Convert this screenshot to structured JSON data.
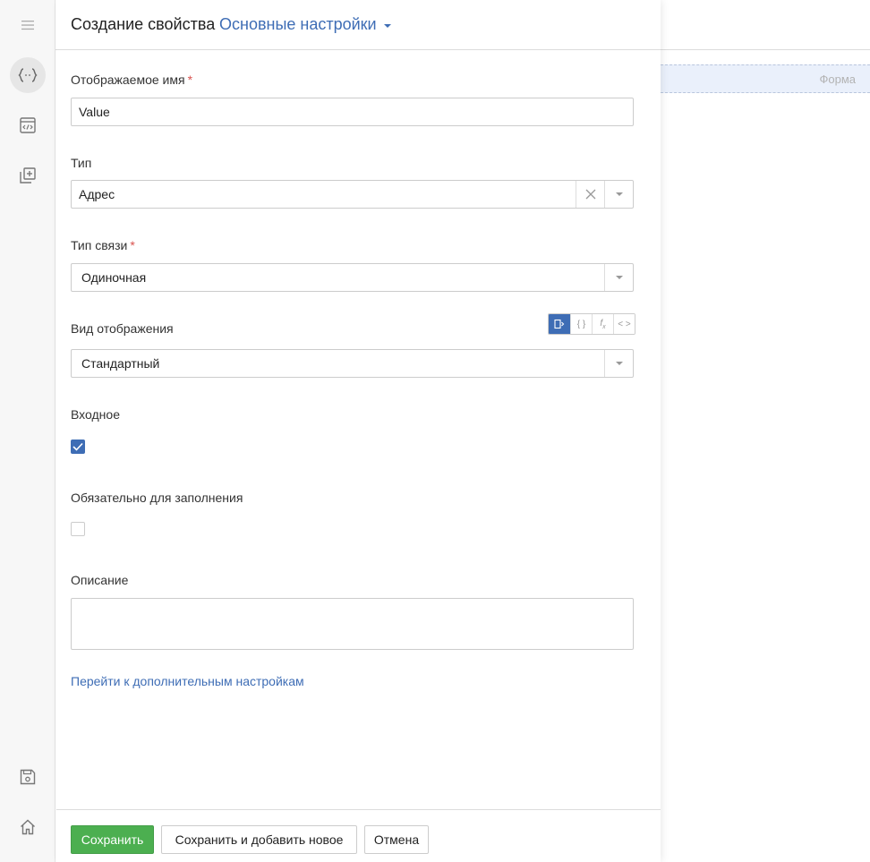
{
  "canvas": {
    "form_label": "Форма"
  },
  "sidebar": {
    "items": [
      {
        "name": "menu",
        "icon": "hamburger-icon"
      },
      {
        "name": "variables",
        "icon": "curly-braces-icon",
        "active": true
      },
      {
        "name": "scripts",
        "icon": "code-window-icon"
      },
      {
        "name": "add-page",
        "icon": "add-copy-icon"
      },
      {
        "name": "save",
        "icon": "save-icon"
      },
      {
        "name": "home",
        "icon": "home-icon"
      }
    ]
  },
  "panel": {
    "title": "Создание свойства",
    "subtitle": "Основные настройки"
  },
  "fields": {
    "display_name": {
      "label": "Отображаемое имя",
      "required": "*",
      "value": "Value"
    },
    "type": {
      "label": "Тип",
      "value": "Адрес"
    },
    "link_type": {
      "label": "Тип связи",
      "required": "*",
      "value": "Одиночная"
    },
    "display_mode": {
      "label": "Вид отображения",
      "value": "Стандартный",
      "mode_buttons": [
        "list-icon",
        "curly-braces-icon",
        "function-icon",
        "code-icon"
      ],
      "active_mode": 0
    },
    "input": {
      "label": "Входное",
      "checked": true
    },
    "required_field": {
      "label": "Обязательно для заполнения",
      "checked": false
    },
    "description": {
      "label": "Описание",
      "value": ""
    }
  },
  "advanced_link": "Перейти к дополнительным настройкам",
  "footer": {
    "save": "Сохранить",
    "save_add": "Сохранить и добавить новое",
    "cancel": "Отмена"
  },
  "colors": {
    "accent": "#3e6db5",
    "primary_button": "#4caf50",
    "required": "#d9534f"
  }
}
